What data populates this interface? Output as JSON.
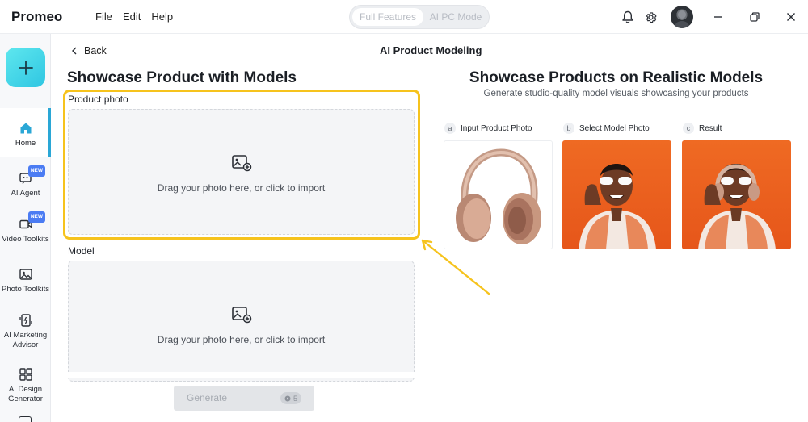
{
  "app": {
    "name": "Promeo"
  },
  "menu": [
    "File",
    "Edit",
    "Help"
  ],
  "mode_toggle": {
    "full": "Full Features",
    "pc": "AI PC Mode"
  },
  "titlebar_icons": [
    "bell-icon",
    "gear-icon",
    "avatar",
    "minimize-icon",
    "restore-icon",
    "close-icon"
  ],
  "sidebar": {
    "new_label": "+",
    "items": [
      {
        "label": "Home",
        "icon": "home-icon",
        "active": true
      },
      {
        "label": "AI Agent",
        "icon": "ai-agent-icon",
        "badge": "NEW"
      },
      {
        "label": "Video Toolkits",
        "icon": "video-icon",
        "badge": "NEW"
      },
      {
        "label": "Photo Toolkits",
        "icon": "photo-icon"
      },
      {
        "label": "AI Marketing Advisor",
        "icon": "marketing-icon"
      },
      {
        "label": "AI Design Generator",
        "icon": "design-grid-icon"
      }
    ]
  },
  "header": {
    "back": "Back",
    "title": "AI Product Modeling"
  },
  "left": {
    "title": "Showcase Product with Models",
    "product_label": "Product photo",
    "product_drop": "Drag your photo here, or click to import",
    "model_label": "Model",
    "model_drop": "Drag your photo here, or click to import",
    "generate": {
      "label": "Generate",
      "cost": "5"
    }
  },
  "right": {
    "title": "Showcase Products on Realistic Models",
    "subtitle": "Generate studio-quality model visuals showcasing your products",
    "steps": [
      {
        "letter": "a",
        "label": "Input Product Photo"
      },
      {
        "letter": "b",
        "label": "Select Model Photo"
      },
      {
        "letter": "c",
        "label": "Result"
      }
    ]
  },
  "colors": {
    "accent": "#2aa7d6",
    "highlight": "#f6c31d",
    "orange_bg": "#ec6420"
  }
}
